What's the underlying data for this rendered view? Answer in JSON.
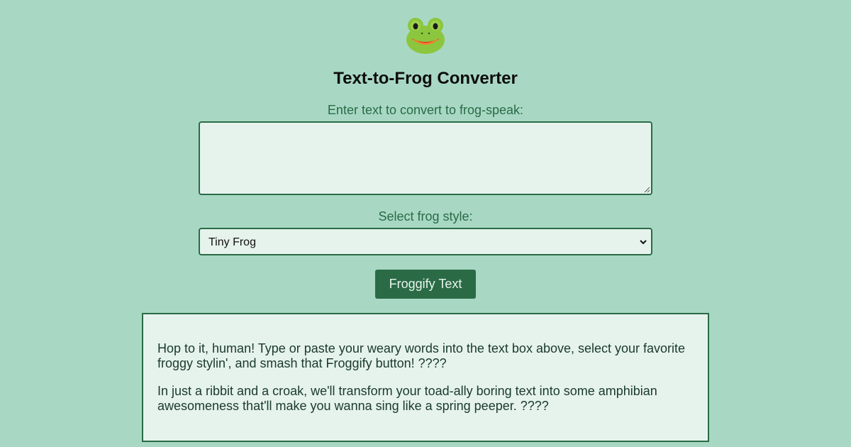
{
  "header": {
    "logo_icon": "frog-face-icon",
    "title": "Text-to-Frog Converter"
  },
  "form": {
    "input_label": "Enter text to convert to frog-speak:",
    "input_value": "",
    "style_label": "Select frog style:",
    "style_selected": "Tiny Frog",
    "submit_label": "Froggify Text"
  },
  "output": {
    "paragraphs": [
      "Hop to it, human! Type or paste your weary words into the text box above, select your favorite froggy stylin', and smash that Froggify button! ????",
      "In just a ribbit and a croak, we'll transform your toad-ally boring text into some amphibian awesomeness that'll make you wanna sing like a spring peeper. ????"
    ]
  },
  "colors": {
    "background": "#a8d8c4",
    "accent": "#2a6b46",
    "field_background": "#e6f3ed"
  }
}
